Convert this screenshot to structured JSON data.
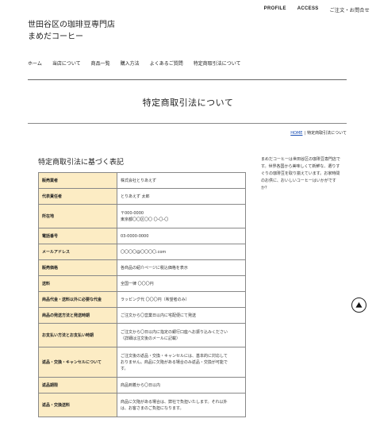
{
  "top_nav": {
    "profile": "PROFILE",
    "access": "ACCESS",
    "contact": "ご注文・お問合せ"
  },
  "site": {
    "title_line1": "世田谷区の珈琲豆専門店",
    "title_line2": "まめだコーヒー"
  },
  "main_nav": [
    "ホーム",
    "当店について",
    "商品一覧",
    "購入方法",
    "よくあるご質問",
    "特定商取引法について"
  ],
  "page_title": "特定商取引法について",
  "breadcrumb": {
    "home": "HOME",
    "separator": "|",
    "current": "特定商取引法について"
  },
  "section_title": "特定商取引法に基づく表記",
  "table": [
    {
      "label": "販売業者",
      "value": "株式会社とりあえず"
    },
    {
      "label": "代表責任者",
      "value": "とりあえず 太郎"
    },
    {
      "label": "所在地",
      "value": "〒000-0000\n東京都〇〇区〇〇 〇-〇-〇"
    },
    {
      "label": "電話番号",
      "value": "03-0000-0000"
    },
    {
      "label": "メールアドレス",
      "value": "〇〇〇〇@〇〇〇〇.com"
    },
    {
      "label": "販売価格",
      "value": "各商品の紹介ページに税込価格を表示"
    },
    {
      "label": "送料",
      "value": "全国一律 〇〇〇円"
    },
    {
      "label": "商品代金・送料以外に必要な代金",
      "value": "ラッピング代 〇〇〇円（希望者のみ）"
    },
    {
      "label": "商品の発送方法と発送時期",
      "value": "ご注文から〇営業日以内に宅配便にて発送"
    },
    {
      "label": "お支払い方法とお支払い時期",
      "value": "ご注文から〇日以内に指定の銀行口座へお振り込みください\n（詳細は注文後のメールに記載）"
    },
    {
      "label": "返品・交換・キャンセルについて",
      "value": "ご注文後の返品・交換・キャンセルには、基本的に対応して\nおりません。商品に欠陥がある場合のみ返品・交換が可能で\nす。"
    },
    {
      "label": "返品期限",
      "value": "商品到着から〇日以内"
    },
    {
      "label": "返品・交換送料",
      "value": "商品に欠陥がある場合は、弊社で負担いたします。それ以外\nは、お客さまのご負担になります。"
    }
  ],
  "sidebar": {
    "text": "まめだコーヒーは世田谷区の珈琲豆専門店です。世界各国から美味しくて新鮮な、選りすぐりの珈琲豆を取り揃えています。お家時間のお供に、おいしいコーヒーはいかがですか？"
  },
  "scroll_top_icon": "arrow-up-icon"
}
